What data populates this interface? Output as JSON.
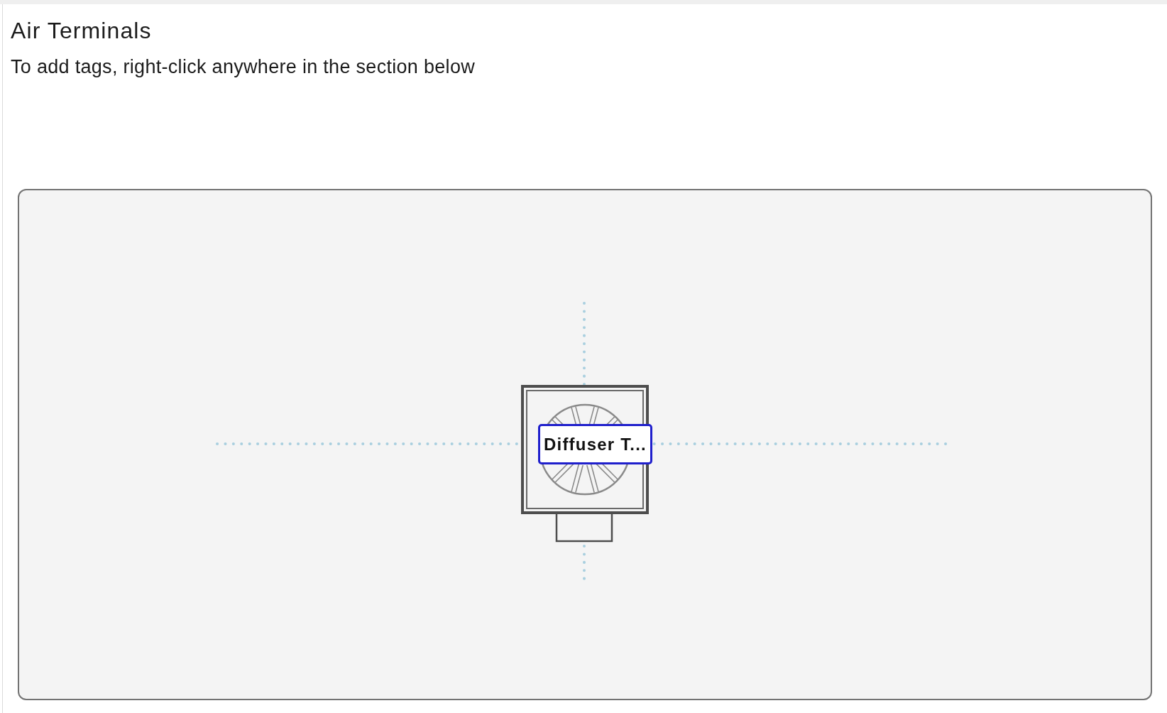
{
  "header": {
    "title": "Air Terminals",
    "hint": "To add tags, right-click anywhere in the section below"
  },
  "canvas": {
    "tags": [
      {
        "label": "Diffuser T...",
        "selected": true
      }
    ]
  }
}
